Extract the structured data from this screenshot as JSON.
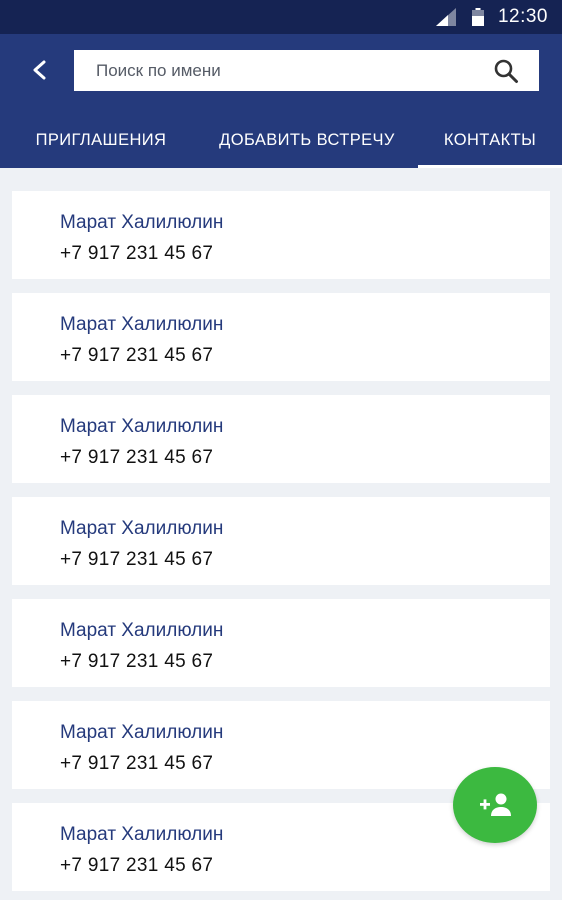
{
  "status_bar": {
    "time": "12:30",
    "icons": [
      "signal-icon",
      "battery-icon"
    ]
  },
  "header": {
    "back_icon": "chevron-left-icon",
    "search": {
      "placeholder": "Поиск по имени",
      "value": "",
      "icon": "search-icon"
    }
  },
  "tabs": [
    {
      "label": "ПРИГЛАШЕНИЯ",
      "active": false
    },
    {
      "label": "ДОБАВИТЬ ВСТРЕЧУ",
      "active": false
    },
    {
      "label": "КОНТАКТЫ",
      "active": true
    }
  ],
  "contacts": [
    {
      "name": "Марат Халилюлин",
      "phone": "+7 917 231 45 67"
    },
    {
      "name": "Марат Халилюлин",
      "phone": "+7 917 231 45 67"
    },
    {
      "name": "Марат Халилюлин",
      "phone": "+7 917 231 45 67"
    },
    {
      "name": "Марат Халилюлин",
      "phone": "+7 917 231 45 67"
    },
    {
      "name": "Марат Халилюлин",
      "phone": "+7 917 231 45 67"
    },
    {
      "name": "Марат Халилюлин",
      "phone": "+7 917 231 45 67"
    },
    {
      "name": "Марат Халилюлин",
      "phone": "+7 917 231 45 67"
    }
  ],
  "fab": {
    "icon": "add-contact-icon"
  },
  "colors": {
    "status_bar": "#152353",
    "header": "#253a7c",
    "background": "#eef1f5",
    "contact_name": "#253a7c",
    "fab": "#3cb940"
  }
}
